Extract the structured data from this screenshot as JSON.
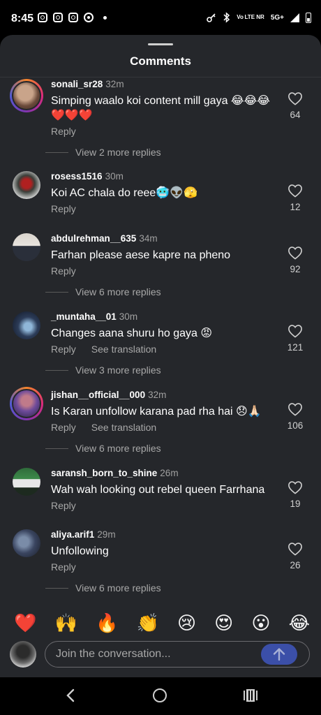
{
  "status_bar": {
    "time": "8:45",
    "network_label": "Vo LTE NR",
    "signal_label": "5G+",
    "icons": [
      "instagram-icon",
      "instagram-icon",
      "instagram-icon",
      "chrome-icon",
      "notification-dot-icon",
      "key-icon",
      "bluetooth-icon",
      "volte-icon",
      "signal-icon",
      "battery-icon"
    ]
  },
  "sheet": {
    "title": "Comments"
  },
  "comments": [
    {
      "username": "sonali_sr28",
      "time": "32m",
      "text": "Simping waalo koi content mill gaya 😂😂😂❤️❤️❤️",
      "reply_label": "Reply",
      "likes": "64",
      "more_replies": "View 2 more replies",
      "story_ring": true
    },
    {
      "username": "rosess1516",
      "time": "30m",
      "text": "Koi AC chala do reee🥶👽🫣",
      "reply_label": "Reply",
      "likes": "12",
      "more_replies": "",
      "story_ring": false
    },
    {
      "username": "abdulrehman__635",
      "time": "34m",
      "text": "Farhan please aese kapre na pheno",
      "reply_label": "Reply",
      "likes": "92",
      "more_replies": "View 6 more replies",
      "story_ring": false
    },
    {
      "username": "_muntaha__01",
      "time": "30m",
      "text": "Changes aana shuru ho gaya 😡",
      "reply_label": "Reply",
      "translation_label": "See translation",
      "likes": "121",
      "more_replies": "View 3 more replies",
      "story_ring": false
    },
    {
      "username": "jishan__official__000",
      "time": "32m",
      "text": "Is Karan unfollow karana pad rha hai 😞🙏🏻",
      "reply_label": "Reply",
      "translation_label": "See translation",
      "likes": "106",
      "more_replies": "View 6 more replies",
      "story_ring": true
    },
    {
      "username": "saransh_born_to_shine",
      "time": "26m",
      "text": "Wah wah looking out rebel queen Farrhana",
      "reply_label": "Reply",
      "likes": "19",
      "more_replies": "",
      "story_ring": false
    },
    {
      "username": "aliya.arif1",
      "time": "29m",
      "text": "Unfollowing",
      "reply_label": "Reply",
      "likes": "26",
      "more_replies": "View 6 more replies",
      "story_ring": false
    }
  ],
  "emoji_bar": [
    "❤️",
    "🙌",
    "🔥",
    "👏",
    "😢",
    "😍",
    "😮",
    "😂"
  ],
  "composer": {
    "placeholder": "Join the conversation..."
  },
  "colors": {
    "sheet_bg": "#25272b",
    "send_button": "#3b4fa8",
    "secondary_text": "#a8a8a8"
  }
}
